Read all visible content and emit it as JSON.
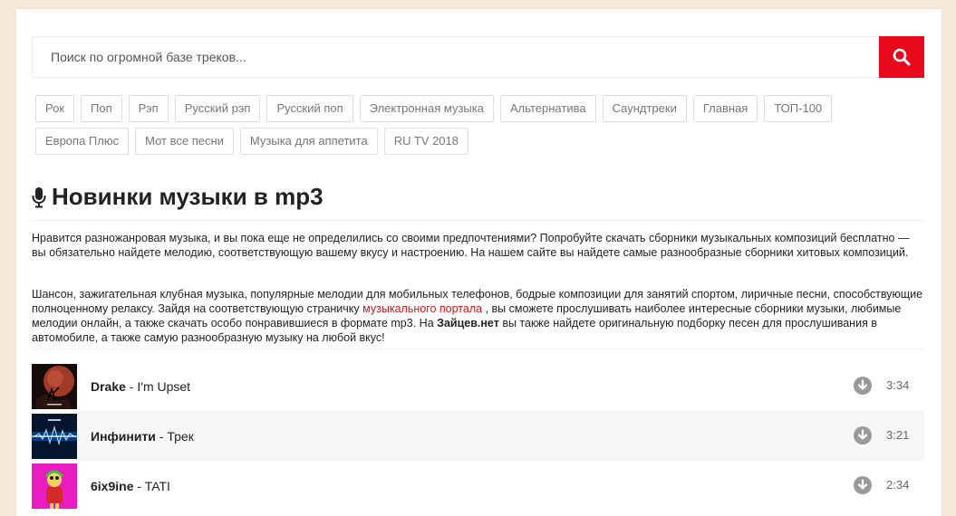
{
  "search": {
    "placeholder": "Поиск по огромной базе треков..."
  },
  "tags_row1": [
    "Рок",
    "Поп",
    "Рэп",
    "Русский рэп",
    "Русский поп",
    "Электронная музыка",
    "Альтернатива",
    "Саундтреки",
    "Главная",
    "ТОП-100"
  ],
  "tags_row2": [
    "Европа Плюс",
    "Мот все песни",
    "Музыка для аппетита",
    "RU TV 2018"
  ],
  "heading": "Новинки музыки в mp3",
  "paragraph1": "Нравится разножанровая музыка, и вы пока еще не определились со своими предпочтениями? Попробуйте скачать сборники музыкальных композиций бесплатно — вы обязательно найдете мелодию, соответствующую вашему вкусу и настроению. На нашем сайте вы найдете самые разнообразные сборники хитовых композиций.",
  "paragraph2": {
    "before": "Шансон, зажигательная клубная музыка, популярные мелодии для мобильных телефонов, бодрые композиции для занятий спортом, лиричные песни, способствующие полноценному релаксу. Зайдя на соответствующую страничку ",
    "link": "музыкального портала",
    "middle": " , вы сможете прослушивать наиболее интересные сборники музыки, любимые мелодии онлайн, а также скачать особо понравившиеся в формате mp3. На ",
    "bold": "Зайцев.нет",
    "after": " вы также найдете оригинальную подборку песен для прослушивания в автомобиле, а также самую разнообразную музыку на любой вкус!"
  },
  "tracks": [
    {
      "artist": "Drake",
      "sep": " - ",
      "title": "I'm Upset",
      "duration": "3:34"
    },
    {
      "artist": "Инфинити",
      "sep": " - ",
      "title": "Трек",
      "duration": "3:21"
    },
    {
      "artist": "6ix9ine",
      "sep": " - ",
      "title": "TATI",
      "duration": "2:34"
    }
  ],
  "colors": {
    "accent": "#e8091d",
    "link": "#d0171c",
    "background": "#f4ead7"
  }
}
